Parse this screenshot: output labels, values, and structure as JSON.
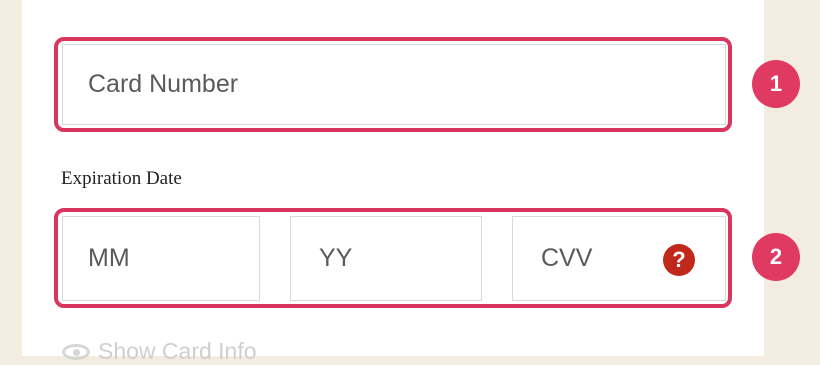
{
  "form": {
    "card_number": {
      "placeholder": "Card Number",
      "value": ""
    },
    "expiration_label": "Expiration Date",
    "month": {
      "placeholder": "MM",
      "value": ""
    },
    "year": {
      "placeholder": "YY",
      "value": ""
    },
    "cvv": {
      "placeholder": "CVV",
      "value": "",
      "help_icon": "question-circle-icon",
      "help_glyph": "?"
    },
    "show_card_info": "Show Card Info",
    "show_card_info_icon": "eye-icon"
  },
  "annotations": {
    "badge_1": "1",
    "badge_2": "2"
  },
  "colors": {
    "highlight": "#d8365e",
    "badge": "#e03a63",
    "help_icon": "#c0281b",
    "background": "#f3ece0"
  }
}
